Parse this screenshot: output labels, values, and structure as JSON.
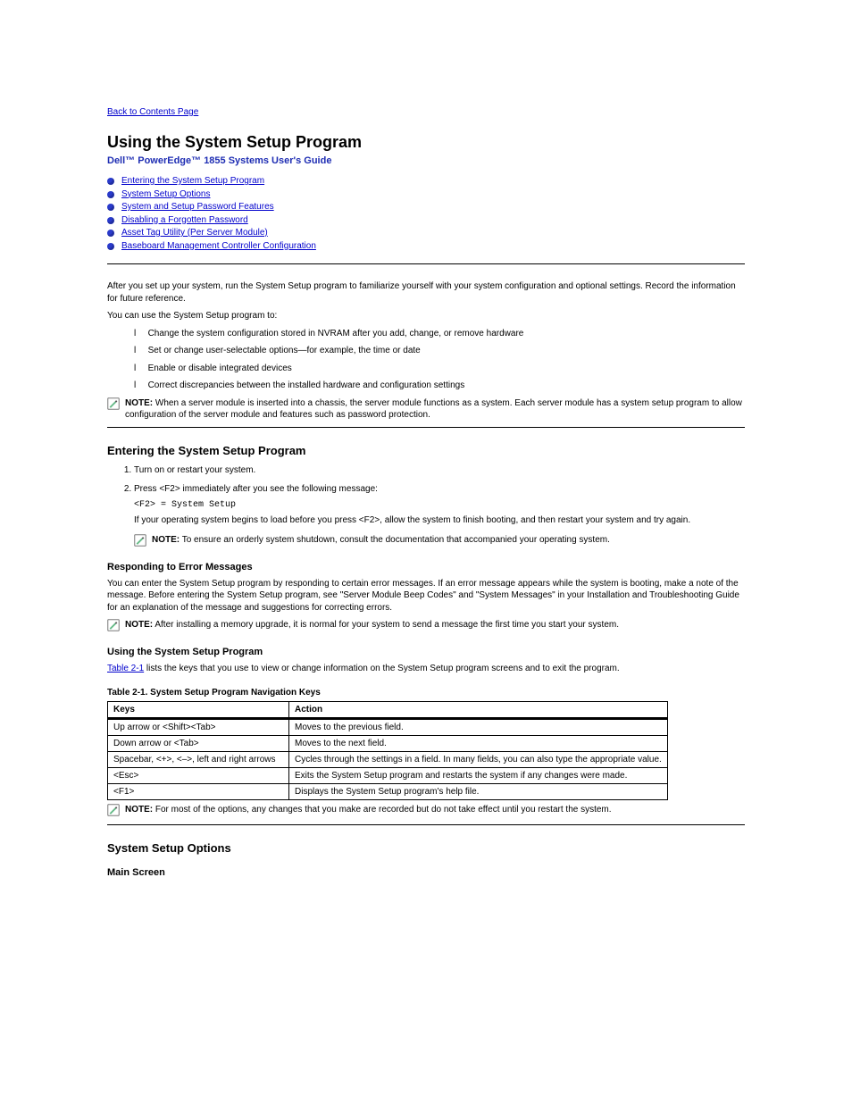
{
  "topLink": "Back to Contents Page",
  "title": "Using the System Setup Program",
  "subtitle": "Dell™ PowerEdge™ 1855 Systems User's Guide",
  "toc": [
    "Entering the System Setup Program",
    "System Setup Options",
    "System and Setup Password Features",
    "Disabling a Forgotten Password",
    "Asset Tag Utility (Per Server Module)",
    "Baseboard Management Controller Configuration"
  ],
  "intro1": "After you set up your system, run the System Setup program to familiarize yourself with your system configuration and optional settings. Record the information for future reference.",
  "intro2": "You can use the System Setup program to:",
  "introBullets": [
    "Change the system configuration stored in NVRAM after you add, change, or remove hardware",
    "Set or change user-selectable options—for example, the time or date",
    "Enable or disable integrated devices",
    "Correct discrepancies between the installed hardware and configuration settings"
  ],
  "note1Label": "NOTE:",
  "note1": "When a server module is inserted into a chassis, the server module functions as a system. Each server module has a system setup program to allow configuration of the server module and features such as password protection.",
  "enteringHeading": "Entering the System Setup Program",
  "steps": [
    {
      "t": "Turn on or restart your system."
    },
    {
      "t": "Press <F2> immediately after you see the following message:",
      "sub": [
        "<F2> = System Setup",
        "If your operating system begins to load before you press <F2>, allow the system to finish booting, and then restart your system and try again."
      ]
    }
  ],
  "note2Label": "NOTE:",
  "note2": "To ensure an orderly system shutdown, consult the documentation that accompanied your operating system.",
  "respondHeading": "Responding to Error Messages",
  "respond1": "You can enter the System Setup program by responding to certain error messages. If an error message appears while the system is booting, make a note of the message. Before entering the System Setup program, see \"Server Module Beep Codes\" and \"System Messages\" in your Installation and Troubleshooting Guide for an explanation of the message and suggestions for correcting errors.",
  "note3Label": "NOTE:",
  "note3": "After installing a memory upgrade, it is normal for your system to send a message the first time you start your system.",
  "usingHeading": "Using the System Setup Program",
  "usingText1Prefix": "",
  "tableRef": "Table 2-1",
  "usingText1Suffix": " lists the keys that you use to view or change information on the System Setup program screens and to exit the program.",
  "tableCaption": "Table 2-1. System Setup Program Navigation Keys ",
  "table": {
    "headers": [
      "Keys",
      "Action"
    ],
    "rows": [
      [
        "Up arrow or <Shift><Tab>",
        "Moves to the previous field."
      ],
      [
        "Down arrow or <Tab>",
        "Moves to the next field."
      ],
      [
        "Spacebar, <+>, <–>, left and right arrows",
        "Cycles through the settings in a field. In many fields, you can also type the appropriate value."
      ],
      [
        "<Esc>",
        "Exits the System Setup program and restarts the system if any changes were made."
      ],
      [
        "<F1>",
        "Displays the System Setup program's help file."
      ]
    ]
  },
  "note4Label": "NOTE:",
  "note4": "For most of the options, any changes that you make are recorded but do not take effect until you restart the system.",
  "optionsHeading": "System Setup Options",
  "mainHeading": "Main Screen"
}
